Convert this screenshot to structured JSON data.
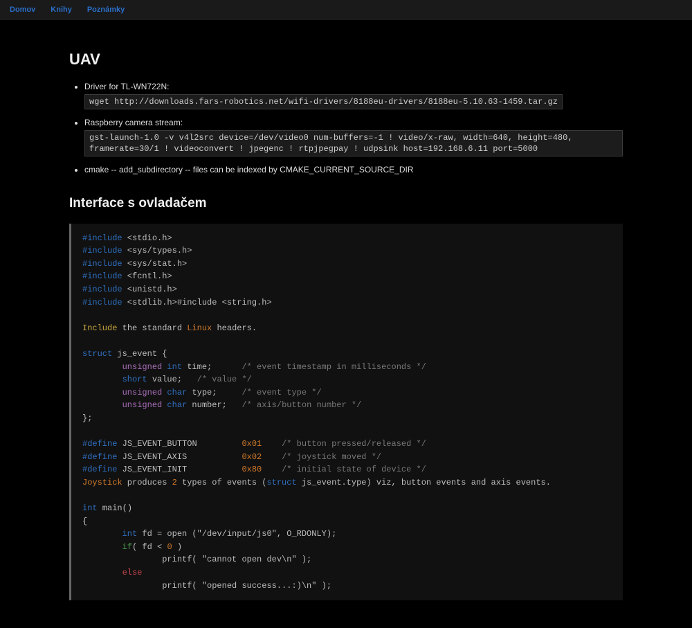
{
  "nav": {
    "home": "Domov",
    "books": "Knihy",
    "notes": "Poznámky"
  },
  "page": {
    "title": "UAV"
  },
  "bullets": {
    "driver_label": "Driver for TL-WN722N:",
    "driver_cmd": "wget http://downloads.fars-robotics.net/wifi-drivers/8188eu-drivers/8188eu-5.10.63-1459.tar.gz",
    "cam_label": "Raspberry camera stream:",
    "cam_cmd": "gst-launch-1.0 -v v4l2src device=/dev/video0 num-buffers=-1 ! video/x-raw, width=640, height=480, framerate=30/1 ! videoconvert ! jpegenc ! rtpjpegpay ! udpsink host=192.168.6.11 port=5000",
    "cmake_note": "cmake -- add_subdirectory -- files can be indexed by CMAKE_CURRENT_SOURCE_DIR"
  },
  "section": {
    "iface_title": "Interface s ovladačem"
  },
  "code": {
    "tokens": {
      "hash_include": "#include",
      "h_stdio": " &lt;stdio.h&gt;",
      "h_systypes": " &lt;sys/types.h&gt;",
      "h_sysstat": " &lt;sys/stat.h&gt;",
      "h_fcntl": " &lt;fcntl.h&gt;",
      "h_unistd": " &lt;unistd.h&gt;",
      "h_stdlib_string": " &lt;stdlib.h&gt;#include &lt;string.h&gt;",
      "include_word": "Include",
      "the_standard": " the standard ",
      "linux_word": "Linux",
      "headers_dot": " headers.",
      "struct_kw": "struct",
      "js_event_decl": " js_event {",
      "unsigned_kw": "unsigned",
      "int_kw": "int",
      "short_kw": "short",
      "char_kw": "char",
      "field_time": " time;      ",
      "field_value": " value;   ",
      "field_type": " type;     ",
      "field_number": " number;   ",
      "cmt_timestamp": "/* event timestamp in milliseconds */",
      "cmt_value": "/* value */",
      "cmt_eventtype": "/* event type */",
      "cmt_axisbtn": "/* axis/button number */",
      "close_struct": "};",
      "hash_define": "#define",
      "def_button": " JS_EVENT_BUTTON         ",
      "def_axis": " JS_EVENT_AXIS           ",
      "def_init": " JS_EVENT_INIT           ",
      "hex01": "0x01",
      "hex02": "0x02",
      "hex80": "0x80",
      "cmt_btn": "    /* button pressed/released */",
      "cmt_joy": "    /* joystick moved */",
      "cmt_init": "    /* initial state of device */",
      "joystick_word": "Joystick",
      "produces": " produces ",
      "two": "2",
      "types_of_events": " types of events (",
      "struct_word2": "struct",
      "js_event_tail": " js_event.type) viz, button events and axis events.",
      "main_decl": " main()",
      "open_brace": "{",
      "fd_assign": " fd = open (&quot;/dev/input/js0&quot;, O_RDONLY);",
      "if_kw": "if",
      "if_cond": "( fd &lt; ",
      "zero": "0",
      "if_close_paren": " )",
      "printf_cannot": "                printf( &quot;cannot open dev\\n&quot; );",
      "else_kw": "else",
      "printf_ok": "                printf( &quot;opened success...:)\\n&quot; );"
    }
  }
}
